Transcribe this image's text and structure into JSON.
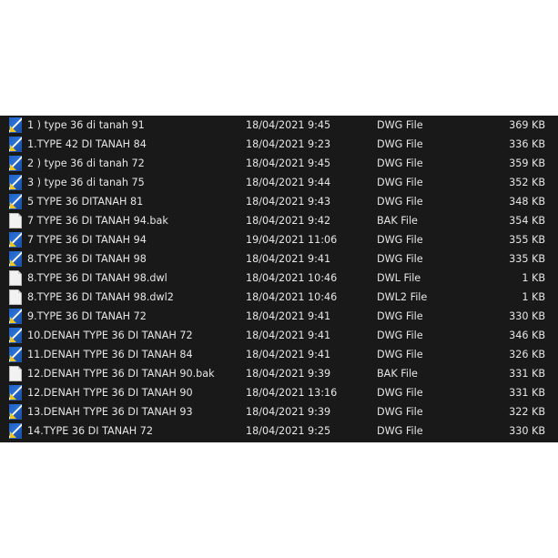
{
  "files": [
    {
      "name": "1 ) type 36 di tanah 91",
      "date": "18/04/2021 9:45",
      "type": "DWG File",
      "size": "369 KB",
      "icon": "dwg-file-icon"
    },
    {
      "name": "1.TYPE 42 DI TANAH 84",
      "date": "18/04/2021 9:23",
      "type": "DWG File",
      "size": "336 KB",
      "icon": "dwg-file-icon"
    },
    {
      "name": "2 ) type 36 di tanah 72",
      "date": "18/04/2021 9:45",
      "type": "DWG File",
      "size": "359 KB",
      "icon": "dwg-file-icon"
    },
    {
      "name": "3 ) type 36 di tanah 75",
      "date": "18/04/2021 9:44",
      "type": "DWG File",
      "size": "352 KB",
      "icon": "dwg-file-icon"
    },
    {
      "name": "5 TYPE 36 DITANAH 81",
      "date": "18/04/2021 9:43",
      "type": "DWG File",
      "size": "348 KB",
      "icon": "dwg-file-icon"
    },
    {
      "name": "7 TYPE 36 DI TANAH 94.bak",
      "date": "18/04/2021 9:42",
      "type": "BAK File",
      "size": "354 KB",
      "icon": "generic-file-icon"
    },
    {
      "name": "7 TYPE 36 DI TANAH 94",
      "date": "19/04/2021 11:06",
      "type": "DWG File",
      "size": "355 KB",
      "icon": "dwg-file-icon"
    },
    {
      "name": "8.TYPE 36 DI TANAH 98",
      "date": "18/04/2021 9:41",
      "type": "DWG File",
      "size": "335 KB",
      "icon": "dwg-file-icon"
    },
    {
      "name": "8.TYPE 36 DI TANAH 98.dwl",
      "date": "18/04/2021 10:46",
      "type": "DWL File",
      "size": "1 KB",
      "icon": "generic-file-icon"
    },
    {
      "name": "8.TYPE 36 DI TANAH 98.dwl2",
      "date": "18/04/2021 10:46",
      "type": "DWL2 File",
      "size": "1 KB",
      "icon": "generic-file-icon"
    },
    {
      "name": "9.TYPE 36 DI TANAH 72",
      "date": "18/04/2021 9:41",
      "type": "DWG File",
      "size": "330 KB",
      "icon": "dwg-file-icon"
    },
    {
      "name": "10.DENAH TYPE 36 DI TANAH 72",
      "date": "18/04/2021 9:41",
      "type": "DWG File",
      "size": "346 KB",
      "icon": "dwg-file-icon"
    },
    {
      "name": "11.DENAH TYPE 36 DI TANAH 84",
      "date": "18/04/2021 9:41",
      "type": "DWG File",
      "size": "326 KB",
      "icon": "dwg-file-icon"
    },
    {
      "name": "12.DENAH TYPE 36 DI TANAH 90.bak",
      "date": "18/04/2021 9:39",
      "type": "BAK File",
      "size": "331 KB",
      "icon": "generic-file-icon"
    },
    {
      "name": "12.DENAH TYPE 36 DI TANAH 90",
      "date": "18/04/2021 13:16",
      "type": "DWG File",
      "size": "331 KB",
      "icon": "dwg-file-icon"
    },
    {
      "name": "13.DENAH TYPE 36 DI TANAH 93",
      "date": "18/04/2021 9:39",
      "type": "DWG File",
      "size": "322 KB",
      "icon": "dwg-file-icon"
    },
    {
      "name": "14.TYPE 36 DI TANAH 72",
      "date": "18/04/2021 9:25",
      "type": "DWG File",
      "size": "330 KB",
      "icon": "dwg-file-icon"
    }
  ],
  "colors": {
    "panel_background": "#191919",
    "text": "#e6e6e6",
    "dwg_icon_blue": "#1f5fbf",
    "dwg_icon_yellow": "#f5c518"
  }
}
